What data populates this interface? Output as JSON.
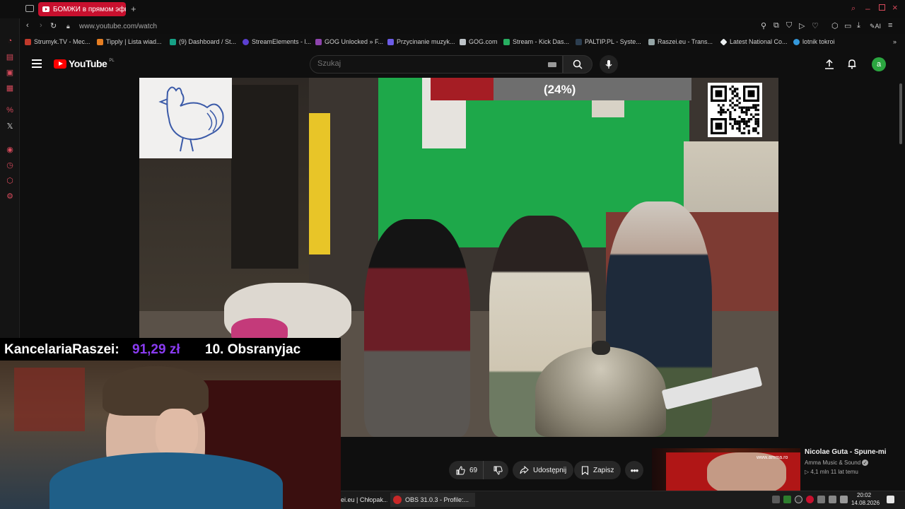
{
  "browser": {
    "active_tab_title": "БОМЖИ в прямом эфире",
    "url": "www.youtube.com/watch",
    "ai_label": "AI",
    "bookmarks": [
      {
        "label": "Strumyk.TV - Mec...",
        "color": "#c0392b"
      },
      {
        "label": "Tipply | Lista wiad...",
        "color": "#e67e22"
      },
      {
        "label": "(9) Dashboard / St...",
        "color": "#16a085"
      },
      {
        "label": "StreamElements - l...",
        "color": "#5b3fd1"
      },
      {
        "label": "GOG Unlocked » F...",
        "color": "#8e44ad"
      },
      {
        "label": "Przycinanie muzyk...",
        "color": "#6c5ce7"
      },
      {
        "label": "GOG.com",
        "color": "#bdc3c7"
      },
      {
        "label": "Stream - Kick Das...",
        "color": "#27ae60"
      },
      {
        "label": "PALTIP.PL - Syste...",
        "color": "#2c3e50"
      },
      {
        "label": "Raszei.eu - Trans...",
        "color": "#95a5a6"
      },
      {
        "label": "Latest National Co...",
        "color": "#ecf0f1"
      },
      {
        "label": "lotnik tokroi",
        "color": "#3498db"
      }
    ]
  },
  "youtube": {
    "wordmark": "YouTube",
    "region": "PL",
    "search_placeholder": "Szukaj",
    "avatar_letter": "a",
    "like_count": "69",
    "share_label": "Udostępnij",
    "save_label": "Zapisz"
  },
  "video_overlay": {
    "progress_label": "(24%)",
    "progress_fraction": 0.24
  },
  "stream_overlay": {
    "donor_name": "KancelariaRaszei:",
    "donor_amount": "91,29 zł",
    "ranking_text": "10. Obsranyjac"
  },
  "recommended": {
    "title": "Nicolae Guta - Spune-mi",
    "channel": "Amma Music & Sound",
    "meta": "▷ 4,1 mln   11 lat temu",
    "watermark": "www.amma.ro"
  },
  "taskbar": {
    "item1": "ei.eu | Chłopak...",
    "item2": "OBS 31.0.3 - Profile:...",
    "time": "20:02",
    "date": "14.08.2026"
  },
  "colors": {
    "youtube_red": "#ff0000",
    "tab_active": "#c8102e",
    "progress_fill": "#a51d24",
    "donor_amount": "#8a3bf2",
    "avatar_bg": "#2ba640"
  }
}
